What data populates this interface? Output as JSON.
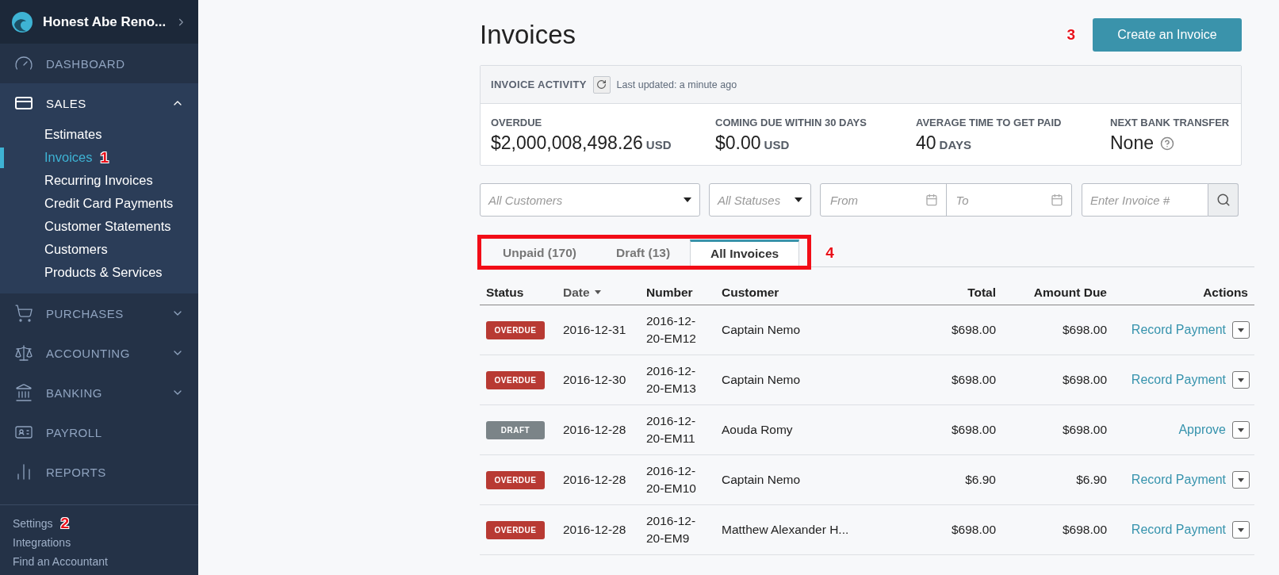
{
  "business": {
    "name": "Honest Abe Reno..."
  },
  "nav": [
    {
      "kind": "dashboard",
      "label": "DASHBOARD"
    },
    {
      "kind": "sales",
      "label": "SALES",
      "expanded": true,
      "children": [
        {
          "label": "Estimates",
          "selected": false
        },
        {
          "label": "Invoices",
          "selected": true,
          "marker": "1"
        },
        {
          "label": "Recurring Invoices",
          "selected": false
        },
        {
          "label": "Credit Card Payments",
          "selected": false
        },
        {
          "label": "Customer Statements",
          "selected": false
        },
        {
          "label": "Customers",
          "selected": false
        },
        {
          "label": "Products & Services",
          "selected": false
        }
      ]
    },
    {
      "kind": "purchases",
      "label": "PURCHASES",
      "expanded": false
    },
    {
      "kind": "accounting",
      "label": "ACCOUNTING",
      "expanded": false
    },
    {
      "kind": "banking",
      "label": "BANKING",
      "expanded": false
    },
    {
      "kind": "payroll",
      "label": "PAYROLL"
    },
    {
      "kind": "reports",
      "label": "REPORTS"
    }
  ],
  "footer_links": [
    {
      "label": "Settings",
      "marker": "2"
    },
    {
      "label": "Integrations"
    },
    {
      "label": "Find an Accountant"
    }
  ],
  "page": {
    "title": "Invoices",
    "create_button": "Create an Invoice",
    "create_marker": "3"
  },
  "activity": {
    "title": "INVOICE ACTIVITY",
    "updated": "Last updated: a minute ago",
    "stats": [
      {
        "label": "OVERDUE",
        "value": "$2,000,008,498.26",
        "unit": "USD"
      },
      {
        "label": "COMING DUE WITHIN 30 DAYS",
        "value": "$0.00",
        "unit": "USD"
      },
      {
        "label": "AVERAGE TIME TO GET PAID",
        "value": "40",
        "unit": "DAYS"
      },
      {
        "label": "NEXT BANK TRANSFER",
        "value": "None",
        "help": true
      }
    ]
  },
  "filters": {
    "customers": {
      "placeholder": "All Customers"
    },
    "statuses": {
      "placeholder": "All Statuses"
    },
    "from": {
      "placeholder": "From"
    },
    "to": {
      "placeholder": "To"
    },
    "invoice": {
      "placeholder": "Enter Invoice #"
    }
  },
  "tabs": {
    "marker": "4",
    "items": [
      {
        "label": "Unpaid (170)",
        "selected": false
      },
      {
        "label": "Draft (13)",
        "selected": false
      },
      {
        "label": "All Invoices",
        "selected": true
      }
    ]
  },
  "table": {
    "columns": [
      {
        "label": "Status"
      },
      {
        "label": "Date",
        "sorted": true
      },
      {
        "label": "Number"
      },
      {
        "label": "Customer"
      },
      {
        "label": "Total"
      },
      {
        "label": "Amount Due"
      },
      {
        "label": "Actions"
      }
    ],
    "rows": [
      {
        "status": "OVERDUE",
        "kind": "overdue",
        "date": "2016-12-31",
        "number": [
          "2016-12-",
          "20-EM12"
        ],
        "customer": "Captain Nemo",
        "total": "$698.00",
        "due": "$698.00",
        "action": "Record Payment"
      },
      {
        "status": "OVERDUE",
        "kind": "overdue",
        "date": "2016-12-30",
        "number": [
          "2016-12-",
          "20-EM13"
        ],
        "customer": "Captain Nemo",
        "total": "$698.00",
        "due": "$698.00",
        "action": "Record Payment"
      },
      {
        "status": "DRAFT",
        "kind": "draft",
        "date": "2016-12-28",
        "number": [
          "2016-12-",
          "20-EM11"
        ],
        "customer": "Aouda Romy",
        "total": "$698.00",
        "due": "$698.00",
        "action": "Approve"
      },
      {
        "status": "OVERDUE",
        "kind": "overdue",
        "date": "2016-12-28",
        "number": [
          "2016-12-",
          "20-EM10"
        ],
        "customer": "Captain Nemo",
        "total": "$6.90",
        "due": "$6.90",
        "action": "Record Payment"
      },
      {
        "status": "OVERDUE",
        "kind": "overdue",
        "date": "2016-12-28",
        "number": [
          "2016-12-",
          "20-EM9"
        ],
        "customer": "Matthew Alexander H...",
        "total": "$698.00",
        "due": "$698.00",
        "action": "Record Payment"
      }
    ]
  }
}
